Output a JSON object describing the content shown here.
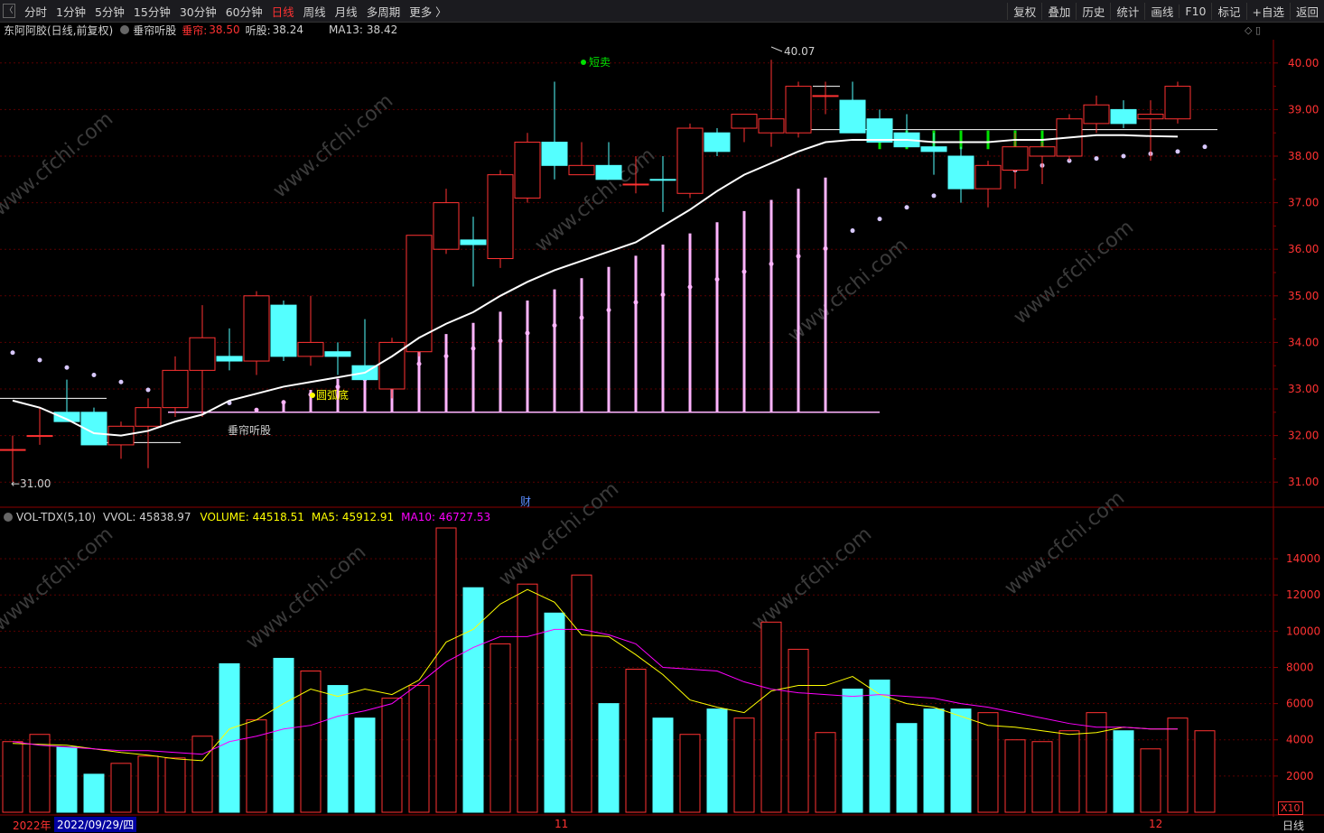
{
  "toolbar": {
    "periods": [
      "分时",
      "1分钟",
      "5分钟",
      "15分钟",
      "30分钟",
      "60分钟",
      "日线",
      "周线",
      "月线",
      "多周期",
      "更多 〉"
    ],
    "active_period": "日线",
    "tools": [
      "复权",
      "叠加",
      "历史",
      "统计",
      "画线",
      "F10",
      "标记",
      "+自选",
      "返回"
    ]
  },
  "price_info": {
    "stock": "东阿阿胶(日线,前复权)",
    "indicator": "垂帘听股",
    "label_red": "垂帘:",
    "value_red": "38.50",
    "label_white": "听股:",
    "value_white": "38.24",
    "ma": "MA13:",
    "ma_value": "38.42"
  },
  "volume_info": {
    "name": "VOL-TDX(5,10)",
    "vvol": "VVOL: 45838.97",
    "volume": "VOLUME: 44518.51",
    "ma5": "MA5: 45912.91",
    "ma10": "MA10: 46727.53"
  },
  "annotations": {
    "high": "40.07",
    "low": "←31.00",
    "short_sell": "短卖",
    "round_bottom": "圆弧底",
    "line_name": "垂帘听股",
    "marker": "财"
  },
  "price_axis": [
    "40.00",
    "39.00",
    "38.00",
    "37.00",
    "36.00",
    "35.00",
    "34.00",
    "33.00",
    "32.00",
    "31.00"
  ],
  "vol_axis": [
    "14000",
    "12000",
    "10000",
    "8000",
    "6000",
    "4000",
    "2000"
  ],
  "vol_unit": "X10",
  "bottom": {
    "year": "2022年",
    "date": "2022/09/29/四",
    "nov": "11",
    "dec": "12",
    "period": "日线"
  },
  "watermark": "www.cfchi.com",
  "colors": {
    "up": "#ff3232",
    "down": "#54ffff",
    "ma": "#ffffff",
    "vol_ma5": "#ffff00",
    "vol_ma10": "#ff00ff",
    "bars": "#ffb4ff",
    "grid": "#5a0000"
  },
  "chart_data": {
    "type": "candlestick",
    "candles": [
      [
        31.7,
        32.0,
        31.0,
        31.7,
        "up"
      ],
      [
        32.0,
        32.6,
        31.8,
        32.0,
        "up"
      ],
      [
        32.5,
        33.2,
        32.3,
        32.3,
        "down"
      ],
      [
        32.5,
        32.6,
        31.8,
        31.8,
        "down"
      ],
      [
        31.8,
        32.3,
        31.5,
        32.2,
        "up"
      ],
      [
        32.2,
        32.8,
        31.3,
        32.6,
        "up"
      ],
      [
        32.6,
        33.7,
        32.4,
        33.4,
        "up"
      ],
      [
        33.4,
        34.8,
        32.4,
        34.1,
        "up"
      ],
      [
        33.7,
        34.3,
        33.4,
        33.6,
        "down"
      ],
      [
        33.6,
        35.1,
        33.3,
        35.0,
        "up"
      ],
      [
        34.8,
        34.9,
        33.6,
        33.7,
        "down"
      ],
      [
        34.0,
        35.0,
        33.5,
        33.7,
        "up"
      ],
      [
        33.8,
        34.0,
        33.3,
        33.7,
        "down"
      ],
      [
        33.5,
        34.5,
        33.2,
        33.2,
        "down"
      ],
      [
        33.0,
        34.1,
        32.8,
        34.0,
        "up"
      ],
      [
        33.8,
        36.3,
        33.7,
        36.3,
        "up"
      ],
      [
        36.0,
        37.3,
        35.9,
        37.0,
        "up"
      ],
      [
        36.2,
        36.7,
        35.2,
        36.1,
        "down"
      ],
      [
        35.8,
        37.7,
        35.6,
        37.6,
        "up"
      ],
      [
        37.1,
        38.5,
        37.0,
        38.3,
        "up"
      ],
      [
        38.3,
        39.6,
        37.5,
        37.8,
        "down"
      ],
      [
        37.8,
        38.3,
        37.6,
        37.6,
        "up"
      ],
      [
        37.8,
        38.3,
        37.5,
        37.5,
        "down"
      ],
      [
        37.4,
        38.0,
        37.2,
        37.4,
        "up"
      ],
      [
        37.5,
        38.0,
        36.8,
        37.5,
        "down"
      ],
      [
        37.2,
        38.7,
        37.1,
        38.6,
        "up"
      ],
      [
        38.5,
        38.6,
        38.0,
        38.1,
        "down"
      ],
      [
        38.6,
        38.9,
        38.3,
        38.9,
        "up"
      ],
      [
        38.5,
        40.07,
        38.2,
        38.8,
        "up"
      ],
      [
        38.5,
        39.6,
        38.4,
        39.5,
        "up"
      ],
      [
        39.3,
        39.6,
        38.9,
        39.3,
        "up"
      ],
      [
        39.2,
        39.6,
        38.5,
        38.5,
        "down"
      ],
      [
        38.8,
        39.0,
        38.3,
        38.3,
        "down"
      ],
      [
        38.5,
        38.9,
        38.2,
        38.2,
        "down"
      ],
      [
        38.2,
        38.5,
        37.6,
        38.1,
        "down"
      ],
      [
        38.0,
        38.2,
        37.0,
        37.3,
        "down"
      ],
      [
        37.3,
        37.9,
        36.9,
        37.8,
        "up"
      ],
      [
        37.7,
        38.5,
        37.3,
        38.2,
        "up"
      ],
      [
        38.0,
        38.3,
        37.4,
        38.2,
        "up"
      ],
      [
        38.0,
        38.9,
        37.9,
        38.8,
        "up"
      ],
      [
        38.7,
        39.3,
        38.5,
        39.1,
        "up"
      ],
      [
        39.0,
        39.2,
        38.6,
        38.7,
        "down"
      ],
      [
        38.8,
        39.2,
        37.9,
        38.9,
        "up"
      ],
      [
        38.8,
        39.6,
        38.7,
        39.5,
        "up"
      ]
    ],
    "ma13": [
      32.75,
      32.6,
      32.35,
      32.05,
      32.0,
      32.1,
      32.3,
      32.45,
      32.75,
      32.9,
      33.05,
      33.15,
      33.25,
      33.35,
      33.7,
      34.1,
      34.4,
      34.65,
      35.0,
      35.3,
      35.55,
      35.75,
      35.95,
      36.15,
      36.5,
      36.85,
      37.25,
      37.6,
      37.85,
      38.1,
      38.3,
      38.35,
      38.35,
      38.35,
      38.3,
      38.3,
      38.3,
      38.35,
      38.35,
      38.4,
      38.45,
      38.45,
      38.43,
      38.42
    ],
    "volume": [
      3900,
      4300,
      3600,
      2100,
      2700,
      3100,
      3000,
      4200,
      8200,
      5100,
      8500,
      7800,
      7000,
      5200,
      6300,
      7000,
      15700,
      12400,
      9300,
      12600,
      11000,
      13100,
      6000,
      7900,
      5200,
      4300,
      5700,
      5200,
      10500,
      9000,
      4400,
      6800,
      7300,
      4900,
      5700,
      5700,
      5500,
      4000,
      3900,
      4500,
      5500,
      4500,
      3500,
      5200,
      4500
    ],
    "vol_ma5": [
      3800,
      3750,
      3700,
      3500,
      3300,
      3150,
      2950,
      2850,
      4600,
      5100,
      6000,
      6800,
      6400,
      6800,
      6500,
      7300,
      9400,
      10100,
      11500,
      12300,
      11600,
      9800,
      9700,
      8700,
      7600,
      6200,
      5800,
      5500,
      6700,
      7000,
      7000,
      7500,
      6500,
      6000,
      5800,
      5300,
      4800,
      4700,
      4500,
      4300,
      4400,
      4700,
      4600,
      4600
    ],
    "vol_ma10": [
      3900,
      3700,
      3600,
      3500,
      3400,
      3400,
      3300,
      3200,
      3900,
      4200,
      4600,
      4800,
      5300,
      5600,
      6000,
      7100,
      8300,
      9100,
      9700,
      9700,
      10100,
      10100,
      9800,
      9300,
      8000,
      7900,
      7800,
      7200,
      6800,
      6600,
      6500,
      6400,
      6500,
      6400,
      6300,
      6000,
      5800,
      5500,
      5200,
      4900,
      4700,
      4700,
      4600,
      4600
    ],
    "ylim_price": [
      30.5,
      40.5
    ],
    "ylim_volume": [
      0,
      15700
    ]
  }
}
